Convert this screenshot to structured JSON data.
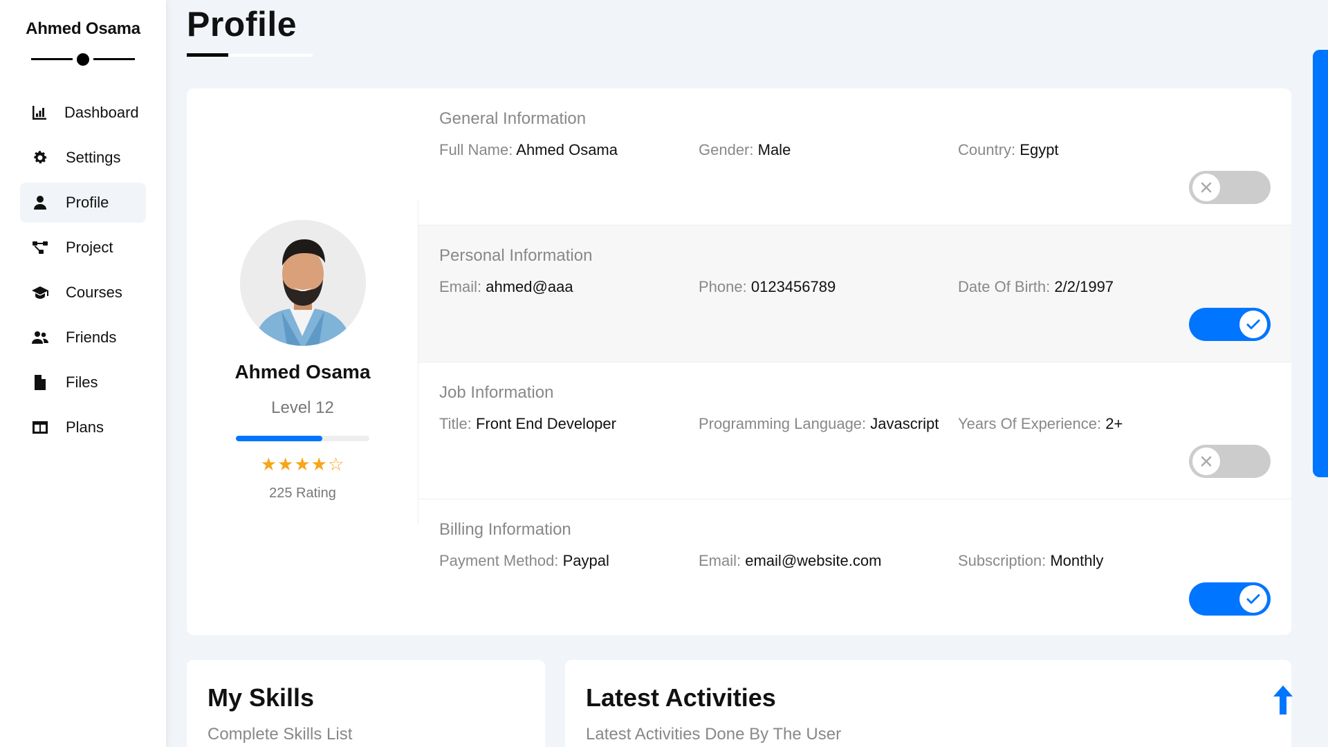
{
  "sidebar": {
    "brand": "Ahmed Osama",
    "items": [
      {
        "label": "Dashboard",
        "icon": "chart-icon"
      },
      {
        "label": "Settings",
        "icon": "gear-icon"
      },
      {
        "label": "Profile",
        "icon": "user-icon",
        "active": true
      },
      {
        "label": "Project",
        "icon": "diagram-project-icon"
      },
      {
        "label": "Courses",
        "icon": "graduation-cap-icon"
      },
      {
        "label": "Friends",
        "icon": "users-icon"
      },
      {
        "label": "Files",
        "icon": "file-icon"
      },
      {
        "label": "Plans",
        "icon": "columns-icon"
      }
    ]
  },
  "page": {
    "title": "Profile"
  },
  "profile": {
    "name": "Ahmed Osama",
    "level": "Level 12",
    "level_progress_percent": 65,
    "stars": "★★★★☆",
    "rating_text": "225 Rating",
    "rating_stars": 4
  },
  "sections": [
    {
      "title": "General Information",
      "fields": [
        {
          "label": "Full Name:",
          "value": "Ahmed Osama"
        },
        {
          "label": "Gender:",
          "value": "Male"
        },
        {
          "label": "Country:",
          "value": "Egypt"
        }
      ],
      "toggle_on": false
    },
    {
      "title": "Personal Information",
      "fields": [
        {
          "label": "Email:",
          "value": "ahmed@aaa"
        },
        {
          "label": "Phone:",
          "value": "0123456789"
        },
        {
          "label": "Date Of Birth:",
          "value": "2/2/1997"
        }
      ],
      "toggle_on": true
    },
    {
      "title": "Job Information",
      "fields": [
        {
          "label": "Title:",
          "value": "Front End Developer"
        },
        {
          "label": "Programming Language:",
          "value": "Javascript"
        },
        {
          "label": "Years Of Experience:",
          "value": "2+"
        }
      ],
      "toggle_on": false
    },
    {
      "title": "Billing Information",
      "fields": [
        {
          "label": "Payment Method:",
          "value": "Paypal"
        },
        {
          "label": "Email:",
          "value": "email@website.com"
        },
        {
          "label": "Subscription:",
          "value": "Monthly"
        }
      ],
      "toggle_on": true
    }
  ],
  "skills": {
    "title": "My Skills",
    "subtitle": "Complete Skills List"
  },
  "activities": {
    "title": "Latest Activities",
    "subtitle": "Latest Activities Done By The User"
  },
  "colors": {
    "accent": "#0075ff",
    "star": "#f7a51b",
    "background": "#f1f5f9"
  }
}
